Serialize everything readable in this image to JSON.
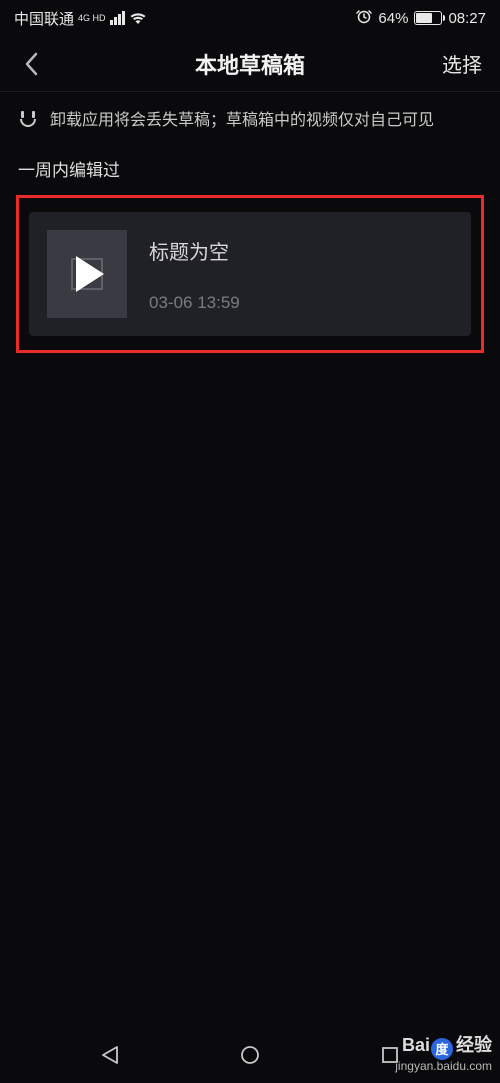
{
  "status": {
    "carrier": "中国联通",
    "network_badge": "4G HD",
    "battery_percent": "64%",
    "time": "08:27"
  },
  "nav": {
    "title": "本地草稿箱",
    "action_label": "选择"
  },
  "info": {
    "text": "卸载应用将会丢失草稿；草稿箱中的视频仅对自己可见"
  },
  "section": {
    "header": "一周内编辑过"
  },
  "drafts": [
    {
      "title": "标题为空",
      "date": "03-06 13:59"
    }
  ],
  "watermark": {
    "brand_prefix": "Bai",
    "brand_paw": "度",
    "brand_suffix": "经验",
    "url": "jingyan.baidu.com"
  }
}
